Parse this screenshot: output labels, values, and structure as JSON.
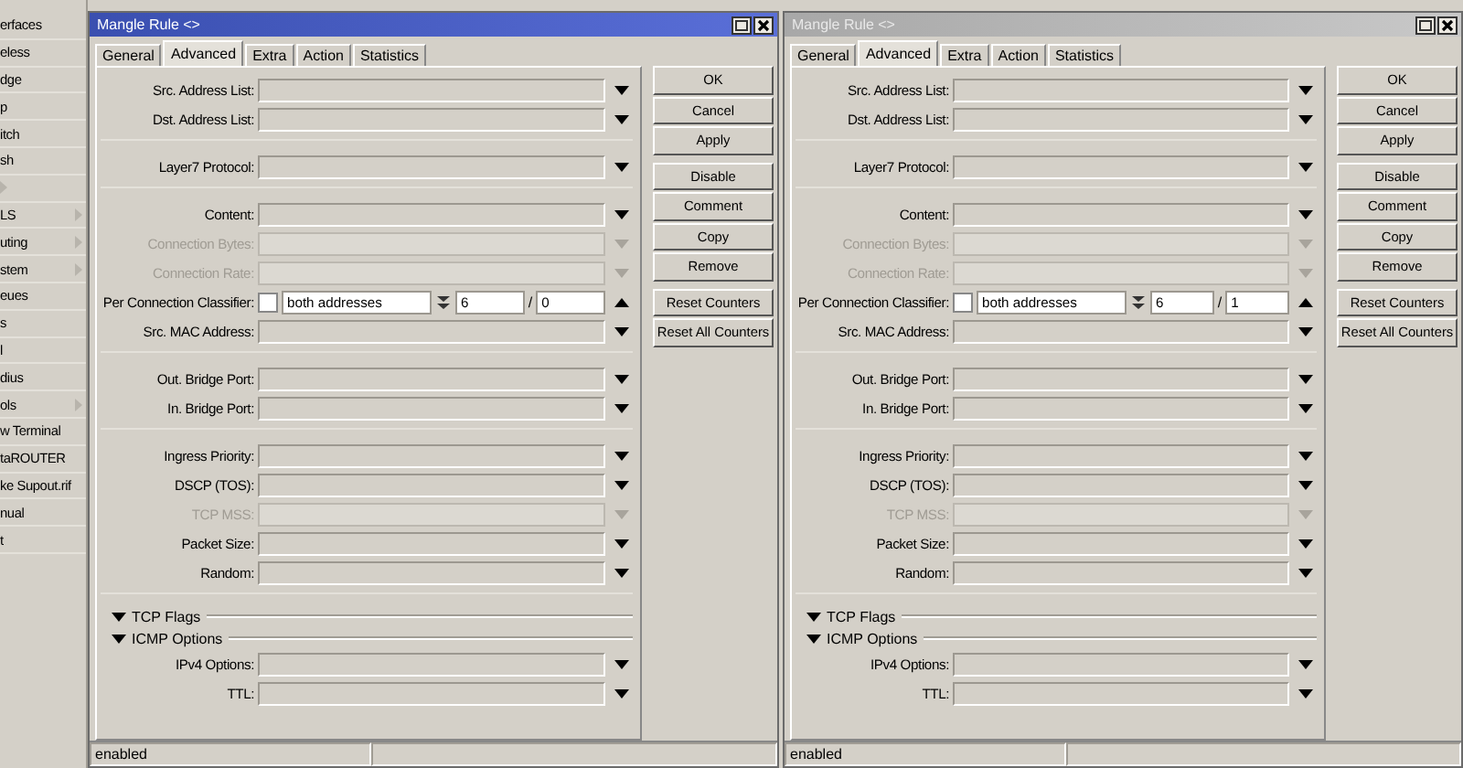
{
  "sidebar": {
    "items": [
      {
        "label": "erfaces",
        "submenu": false
      },
      {
        "label": "eless",
        "submenu": false
      },
      {
        "label": "dge",
        "submenu": false
      },
      {
        "label": "p",
        "submenu": false
      },
      {
        "label": "itch",
        "submenu": false
      },
      {
        "label": "sh",
        "submenu": false
      },
      {
        "submenu": true
      },
      {
        "label": "LS",
        "submenu": true
      },
      {
        "label": "uting",
        "submenu": true
      },
      {
        "label": "stem",
        "submenu": true
      },
      {
        "label": "eues",
        "submenu": false
      },
      {
        "label": "s",
        "submenu": false
      },
      {
        "label": "l",
        "submenu": false
      },
      {
        "label": "dius",
        "submenu": false
      },
      {
        "label": "ols",
        "submenu": true
      },
      {
        "label": "w Terminal",
        "submenu": false
      },
      {
        "label": "taROUTER",
        "submenu": false
      },
      {
        "label": "ke Supout.rif",
        "submenu": false
      },
      {
        "label": "nual",
        "submenu": false
      },
      {
        "label": "t",
        "submenu": false
      }
    ]
  },
  "windows": [
    {
      "title": "Mangle Rule <>",
      "active": true,
      "tabs": [
        {
          "label": "General",
          "selected": false
        },
        {
          "label": "Advanced",
          "selected": true
        },
        {
          "label": "Extra",
          "selected": false
        },
        {
          "label": "Action",
          "selected": false
        },
        {
          "label": "Statistics",
          "selected": false
        }
      ],
      "row_groups": [
        [
          {
            "kind": "field",
            "label": "Src. Address List:",
            "disabled": false
          },
          {
            "kind": "field",
            "label": "Dst. Address List:",
            "disabled": false
          }
        ],
        [
          {
            "kind": "field",
            "label": "Layer7 Protocol:",
            "disabled": false
          }
        ],
        [
          {
            "kind": "field",
            "label": "Content:",
            "disabled": false
          },
          {
            "kind": "field",
            "label": "Connection Bytes:",
            "disabled": true
          },
          {
            "kind": "field",
            "label": "Connection Rate:",
            "disabled": true
          },
          {
            "kind": "pcc",
            "label": "Per Connection Classifier:",
            "checked": false,
            "mode": "both addresses",
            "value": "6",
            "slash": "/",
            "count": "0",
            "disabled": false
          },
          {
            "kind": "field",
            "label": "Src. MAC Address:",
            "disabled": false
          }
        ],
        [
          {
            "kind": "field",
            "label": "Out. Bridge Port:",
            "disabled": false
          },
          {
            "kind": "field",
            "label": "In. Bridge Port:",
            "disabled": false
          }
        ],
        [
          {
            "kind": "field",
            "label": "Ingress Priority:",
            "disabled": false
          },
          {
            "kind": "field",
            "label": "DSCP (TOS):",
            "disabled": false
          },
          {
            "kind": "field",
            "label": "TCP MSS:",
            "disabled": true
          },
          {
            "kind": "field",
            "label": "Packet Size:",
            "disabled": false
          },
          {
            "kind": "field",
            "label": "Random:",
            "disabled": false
          }
        ],
        [
          {
            "kind": "section",
            "label": "TCP Flags",
            "expanded": false
          },
          {
            "kind": "section",
            "label": "ICMP Options",
            "expanded": false
          },
          {
            "kind": "field",
            "label": "IPv4 Options:",
            "disabled": false
          },
          {
            "kind": "field",
            "label": "TTL:",
            "disabled": false
          }
        ]
      ],
      "button_groups": [
        [
          "OK",
          "Cancel",
          "Apply"
        ],
        [
          "Disable",
          "Comment",
          "Copy",
          "Remove"
        ],
        [
          "Reset Counters",
          "Reset All Counters"
        ]
      ],
      "status": "enabled"
    },
    {
      "title": "Mangle Rule <>",
      "active": false,
      "tabs": [
        {
          "label": "General",
          "selected": false
        },
        {
          "label": "Advanced",
          "selected": true
        },
        {
          "label": "Extra",
          "selected": false
        },
        {
          "label": "Action",
          "selected": false
        },
        {
          "label": "Statistics",
          "selected": false
        }
      ],
      "row_groups": [
        [
          {
            "kind": "field",
            "label": "Src. Address List:",
            "disabled": false
          },
          {
            "kind": "field",
            "label": "Dst. Address List:",
            "disabled": false
          }
        ],
        [
          {
            "kind": "field",
            "label": "Layer7 Protocol:",
            "disabled": false
          }
        ],
        [
          {
            "kind": "field",
            "label": "Content:",
            "disabled": false
          },
          {
            "kind": "field",
            "label": "Connection Bytes:",
            "disabled": true
          },
          {
            "kind": "field",
            "label": "Connection Rate:",
            "disabled": true
          },
          {
            "kind": "pcc",
            "label": "Per Connection Classifier:",
            "checked": false,
            "mode": "both addresses",
            "value": "6",
            "slash": "/",
            "count": "1",
            "disabled": false
          },
          {
            "kind": "field",
            "label": "Src. MAC Address:",
            "disabled": false
          }
        ],
        [
          {
            "kind": "field",
            "label": "Out. Bridge Port:",
            "disabled": false
          },
          {
            "kind": "field",
            "label": "In. Bridge Port:",
            "disabled": false
          }
        ],
        [
          {
            "kind": "field",
            "label": "Ingress Priority:",
            "disabled": false
          },
          {
            "kind": "field",
            "label": "DSCP (TOS):",
            "disabled": false
          },
          {
            "kind": "field",
            "label": "TCP MSS:",
            "disabled": true
          },
          {
            "kind": "field",
            "label": "Packet Size:",
            "disabled": false
          },
          {
            "kind": "field",
            "label": "Random:",
            "disabled": false
          }
        ],
        [
          {
            "kind": "section",
            "label": "TCP Flags",
            "expanded": false
          },
          {
            "kind": "section",
            "label": "ICMP Options",
            "expanded": false
          },
          {
            "kind": "field",
            "label": "IPv4 Options:",
            "disabled": false
          },
          {
            "kind": "field",
            "label": "TTL:",
            "disabled": false
          }
        ]
      ],
      "button_groups": [
        [
          "OK",
          "Cancel",
          "Apply"
        ],
        [
          "Disable",
          "Comment",
          "Copy",
          "Remove"
        ],
        [
          "Reset Counters",
          "Reset All Counters"
        ]
      ],
      "status": "enabled"
    }
  ]
}
